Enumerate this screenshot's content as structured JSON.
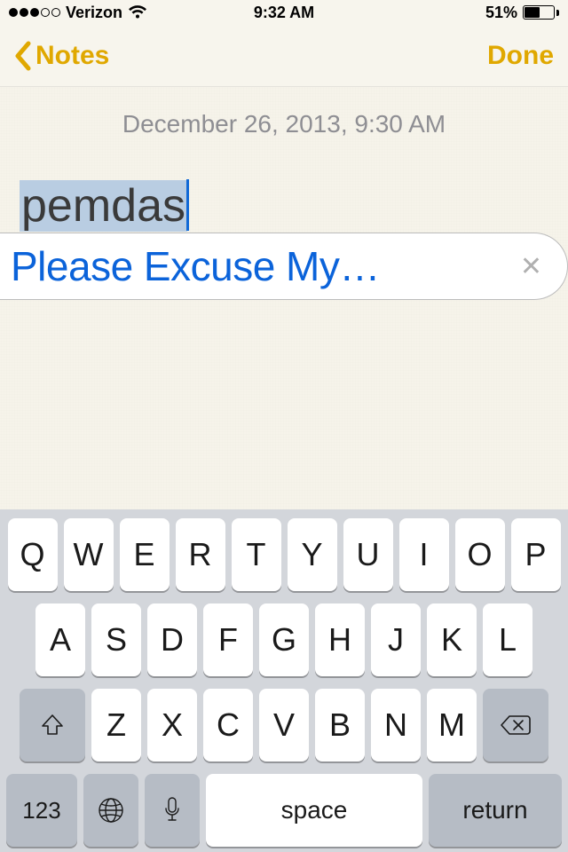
{
  "status": {
    "carrier": "Verizon",
    "time": "9:32 AM",
    "battery_pct": "51%",
    "battery_fill_pct": 51,
    "signal_filled": 3,
    "signal_total": 5
  },
  "nav": {
    "back_label": "Notes",
    "done_label": "Done"
  },
  "note": {
    "timestamp": "December 26, 2013, 9:30 AM",
    "text": "pemdas"
  },
  "suggestion": {
    "text": "Please Excuse My…"
  },
  "keyboard": {
    "row1": [
      "Q",
      "W",
      "E",
      "R",
      "T",
      "Y",
      "U",
      "I",
      "O",
      "P"
    ],
    "row2": [
      "A",
      "S",
      "D",
      "F",
      "G",
      "H",
      "J",
      "K",
      "L"
    ],
    "row3": [
      "Z",
      "X",
      "C",
      "V",
      "B",
      "N",
      "M"
    ],
    "numkey": "123",
    "space": "space",
    "return": "return"
  }
}
